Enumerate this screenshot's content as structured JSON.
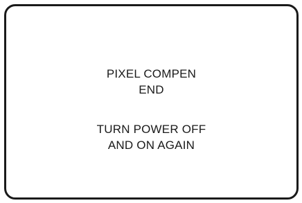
{
  "screen": {
    "lines": [
      "PIXEL COMPEN",
      "END",
      "TURN POWER OFF",
      "AND ON AGAIN"
    ]
  }
}
